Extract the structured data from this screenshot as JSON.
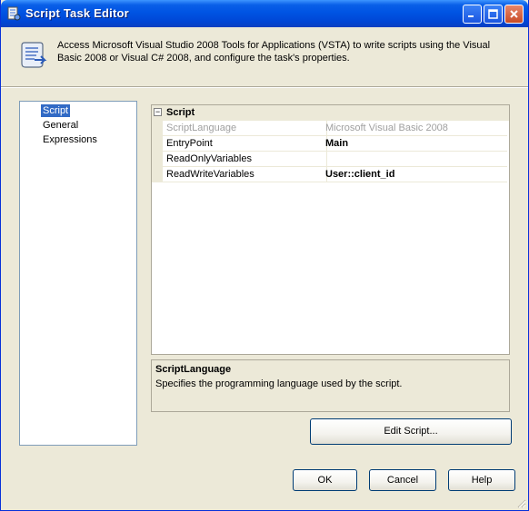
{
  "window": {
    "title": "Script Task Editor"
  },
  "header": {
    "description": "Access Microsoft Visual Studio 2008 Tools for Applications (VSTA) to write scripts using the Visual Basic 2008 or Visual C# 2008, and configure the task's properties."
  },
  "nav": {
    "items": [
      {
        "label": "Script",
        "selected": true
      },
      {
        "label": "General",
        "selected": false
      },
      {
        "label": "Expressions",
        "selected": false
      }
    ]
  },
  "grid": {
    "category": "Script",
    "toggle": "−",
    "rows": [
      {
        "name": "ScriptLanguage",
        "value": "Microsoft Visual Basic 2008",
        "readonly": true
      },
      {
        "name": "EntryPoint",
        "value": "Main",
        "bold": true
      },
      {
        "name": "ReadOnlyVariables",
        "value": ""
      },
      {
        "name": "ReadWriteVariables",
        "value": "User::client_id",
        "bold": true
      }
    ]
  },
  "description_panel": {
    "title": "ScriptLanguage",
    "text": "Specifies the programming language used by the script."
  },
  "buttons": {
    "edit_script": "Edit Script...",
    "ok": "OK",
    "cancel": "Cancel",
    "help": "Help"
  },
  "colors": {
    "titlebar": "#0054e3",
    "selection": "#316ac5",
    "dialog_bg": "#ece9d8"
  }
}
